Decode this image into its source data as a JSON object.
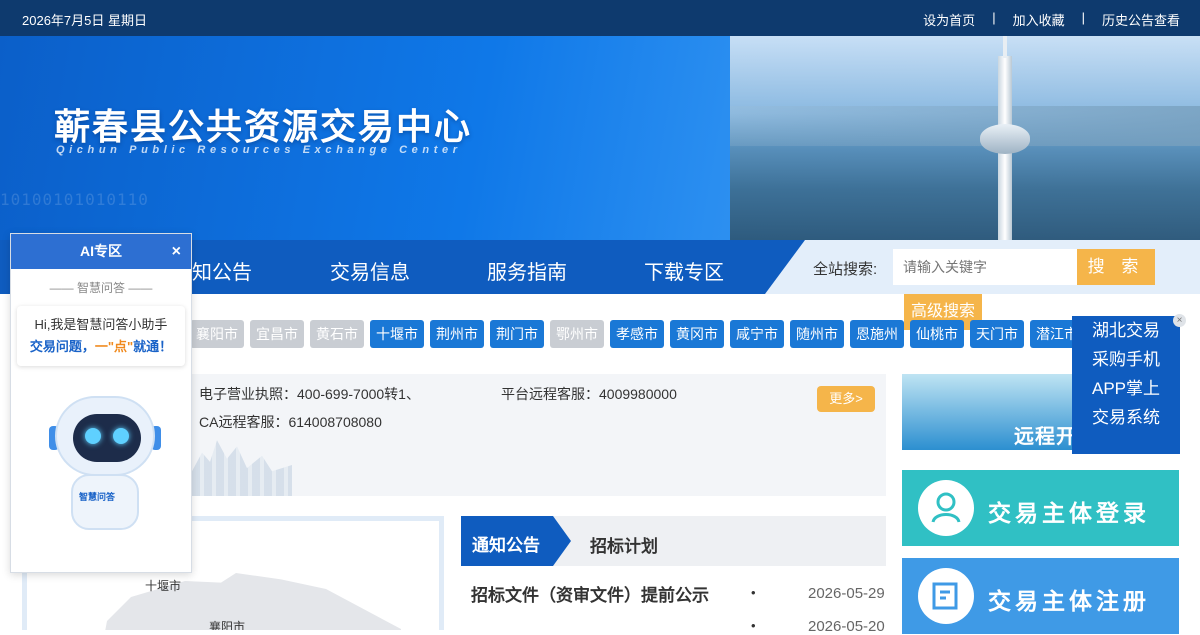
{
  "topbar": {
    "date": "2026年7月5日 星期日",
    "links": [
      "设为首页",
      "加入收藏",
      "历史公告查看"
    ],
    "separator": "|"
  },
  "banner": {
    "title": "蕲春县公共资源交易中心",
    "subtitle": "Qichun Public Resources Exchange Center",
    "binary_text": "10100101010110"
  },
  "nav": {
    "items": [
      "知公告",
      "交易信息",
      "服务指南",
      "下载专区"
    ]
  },
  "search": {
    "label": "全站搜索:",
    "placeholder": "请输入关键字",
    "button": "搜 索",
    "advanced": "高级搜索"
  },
  "cities": [
    {
      "name": "襄阳市",
      "active": false
    },
    {
      "name": "宜昌市",
      "active": false
    },
    {
      "name": "黄石市",
      "active": false
    },
    {
      "name": "十堰市",
      "active": true
    },
    {
      "name": "荆州市",
      "active": true
    },
    {
      "name": "荆门市",
      "active": true
    },
    {
      "name": "鄂州市",
      "active": false
    },
    {
      "name": "孝感市",
      "active": true
    },
    {
      "name": "黄冈市",
      "active": true
    },
    {
      "name": "咸宁市",
      "active": true
    },
    {
      "name": "随州市",
      "active": true
    },
    {
      "name": "恩施州",
      "active": true
    },
    {
      "name": "仙桃市",
      "active": true
    },
    {
      "name": "天门市",
      "active": true
    },
    {
      "name": "潜江市",
      "active": true
    }
  ],
  "notice": {
    "line1": "电子营业执照：400-699-7000转1、",
    "line2": "平台远程客服：4009980000",
    "line3": "CA远程客服：614008708080",
    "more": "更多>"
  },
  "map": {
    "labels": [
      "十堰市",
      "襄阳市"
    ]
  },
  "tabs": {
    "active": "通知公告",
    "second": "招标计划"
  },
  "list": {
    "heading": "招标文件（资审文件）提前公示",
    "dates": [
      "2026-05-29",
      "2026-05-20"
    ]
  },
  "side": {
    "remote": "远程开标入口",
    "login": "交易主体登录",
    "register": "交易主体注册"
  },
  "float_right": {
    "lines": [
      "湖北交易",
      "采购手机",
      "APP掌上",
      "交易系统"
    ],
    "close": "×"
  },
  "ai": {
    "title": "AI专区",
    "close": "×",
    "subtitle": "—— 智慧问答 ——",
    "greeting": "Hi,我是智慧问答小助手",
    "q": "交易问题，",
    "o": "一\"点\"",
    "tail": "就通！",
    "robot_badge": "智慧问答"
  },
  "colors": {
    "nav_blue": "#0f5cbf",
    "accent_orange": "#f5b54a",
    "city_blue": "#1a78d6"
  }
}
